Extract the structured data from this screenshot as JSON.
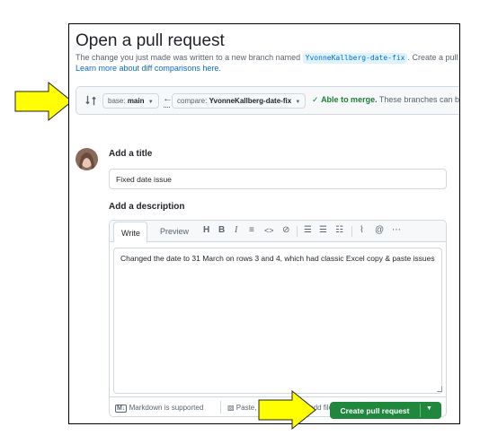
{
  "header": {
    "title": "Open a pull request",
    "subtitle_before": "The change you just made was written to a new branch named",
    "branch_name": "YvonneKallberg-date-fix",
    "subtitle_after": ". Create a pull",
    "learn_link": "Learn more about diff comparisons here."
  },
  "compare": {
    "base_prefix": "base:",
    "base_value": "main",
    "compare_prefix": "compare:",
    "compare_value": "YvonneKallberg-date-fix",
    "merge_ok": "Able to merge.",
    "merge_text": "These branches can be"
  },
  "form": {
    "title_label": "Add a title",
    "title_value": "Fixed date issue",
    "description_label": "Add a description",
    "tabs": [
      "Write",
      "Preview"
    ],
    "toolbar": [
      "H",
      "B",
      "I"
    ],
    "body": "Changed the date to 31 March on rows 3 and 4, which had classic Excel copy & paste issues",
    "markdown_note": "Markdown is supported",
    "attach_note": "Paste, drop, or click to add files",
    "submit_label": "Create pull request"
  },
  "colors": {
    "primary_button": "#1f883d",
    "link": "#0969da",
    "callout_arrow": "#ffff00"
  }
}
